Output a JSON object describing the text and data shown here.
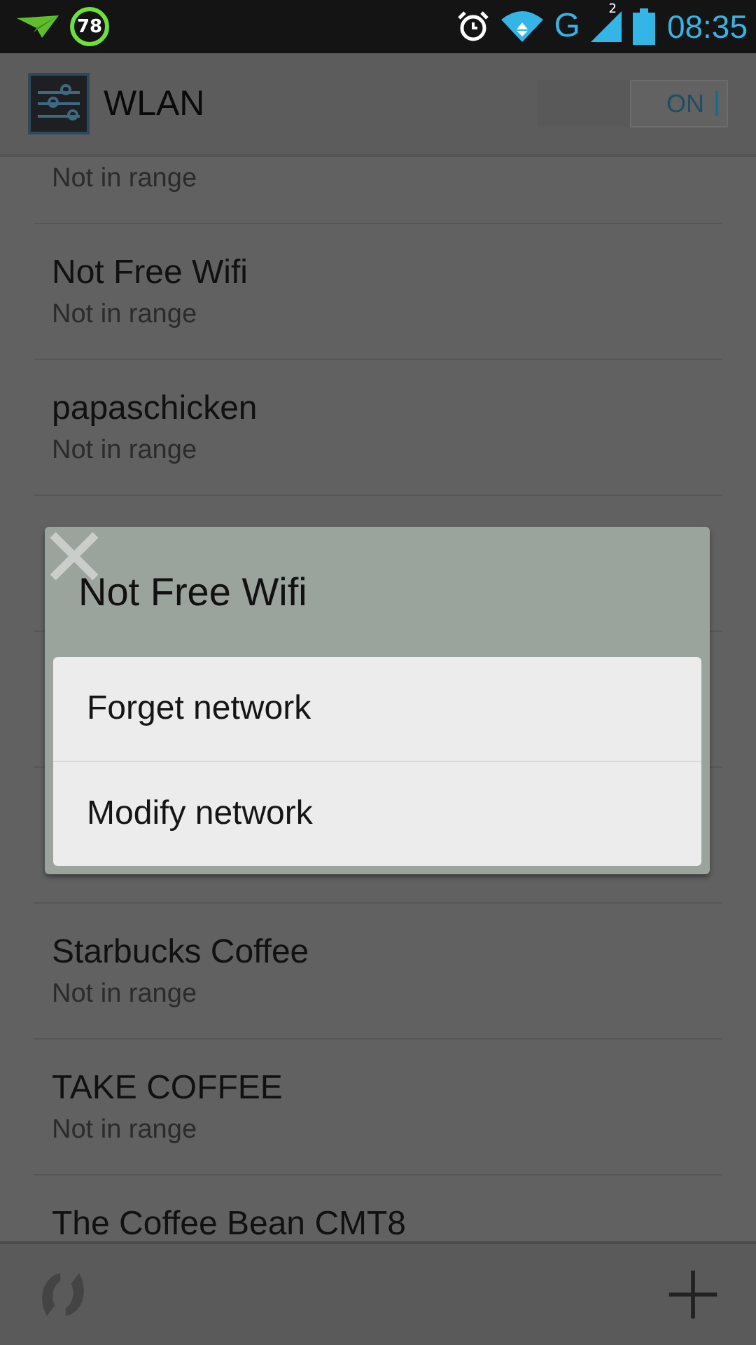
{
  "status_bar": {
    "battery_badge": "78",
    "network_type": "G",
    "sim_slot": "2",
    "time": "08:35"
  },
  "header": {
    "title": "WLAN",
    "toggle": {
      "label": "ON",
      "on": true
    }
  },
  "networks": [
    {
      "kind": "network",
      "subtitle": "Not in range"
    },
    {
      "kind": "network",
      "title": "Not Free Wifi",
      "subtitle": "Not in range"
    },
    {
      "kind": "network",
      "title": "papaschicken",
      "subtitle": "Not in range"
    },
    {
      "kind": "covered"
    },
    {
      "kind": "covered"
    },
    {
      "kind": "covered"
    },
    {
      "kind": "network",
      "title": "Starbucks Coffee",
      "subtitle": "Not in range"
    },
    {
      "kind": "network",
      "title": "TAKE COFFEE",
      "subtitle": "Not in range"
    },
    {
      "kind": "network",
      "title": "The Coffee Bean CMT8"
    }
  ],
  "dialog": {
    "title": "Not Free Wifi",
    "options": [
      "Forget network",
      "Modify network"
    ]
  }
}
